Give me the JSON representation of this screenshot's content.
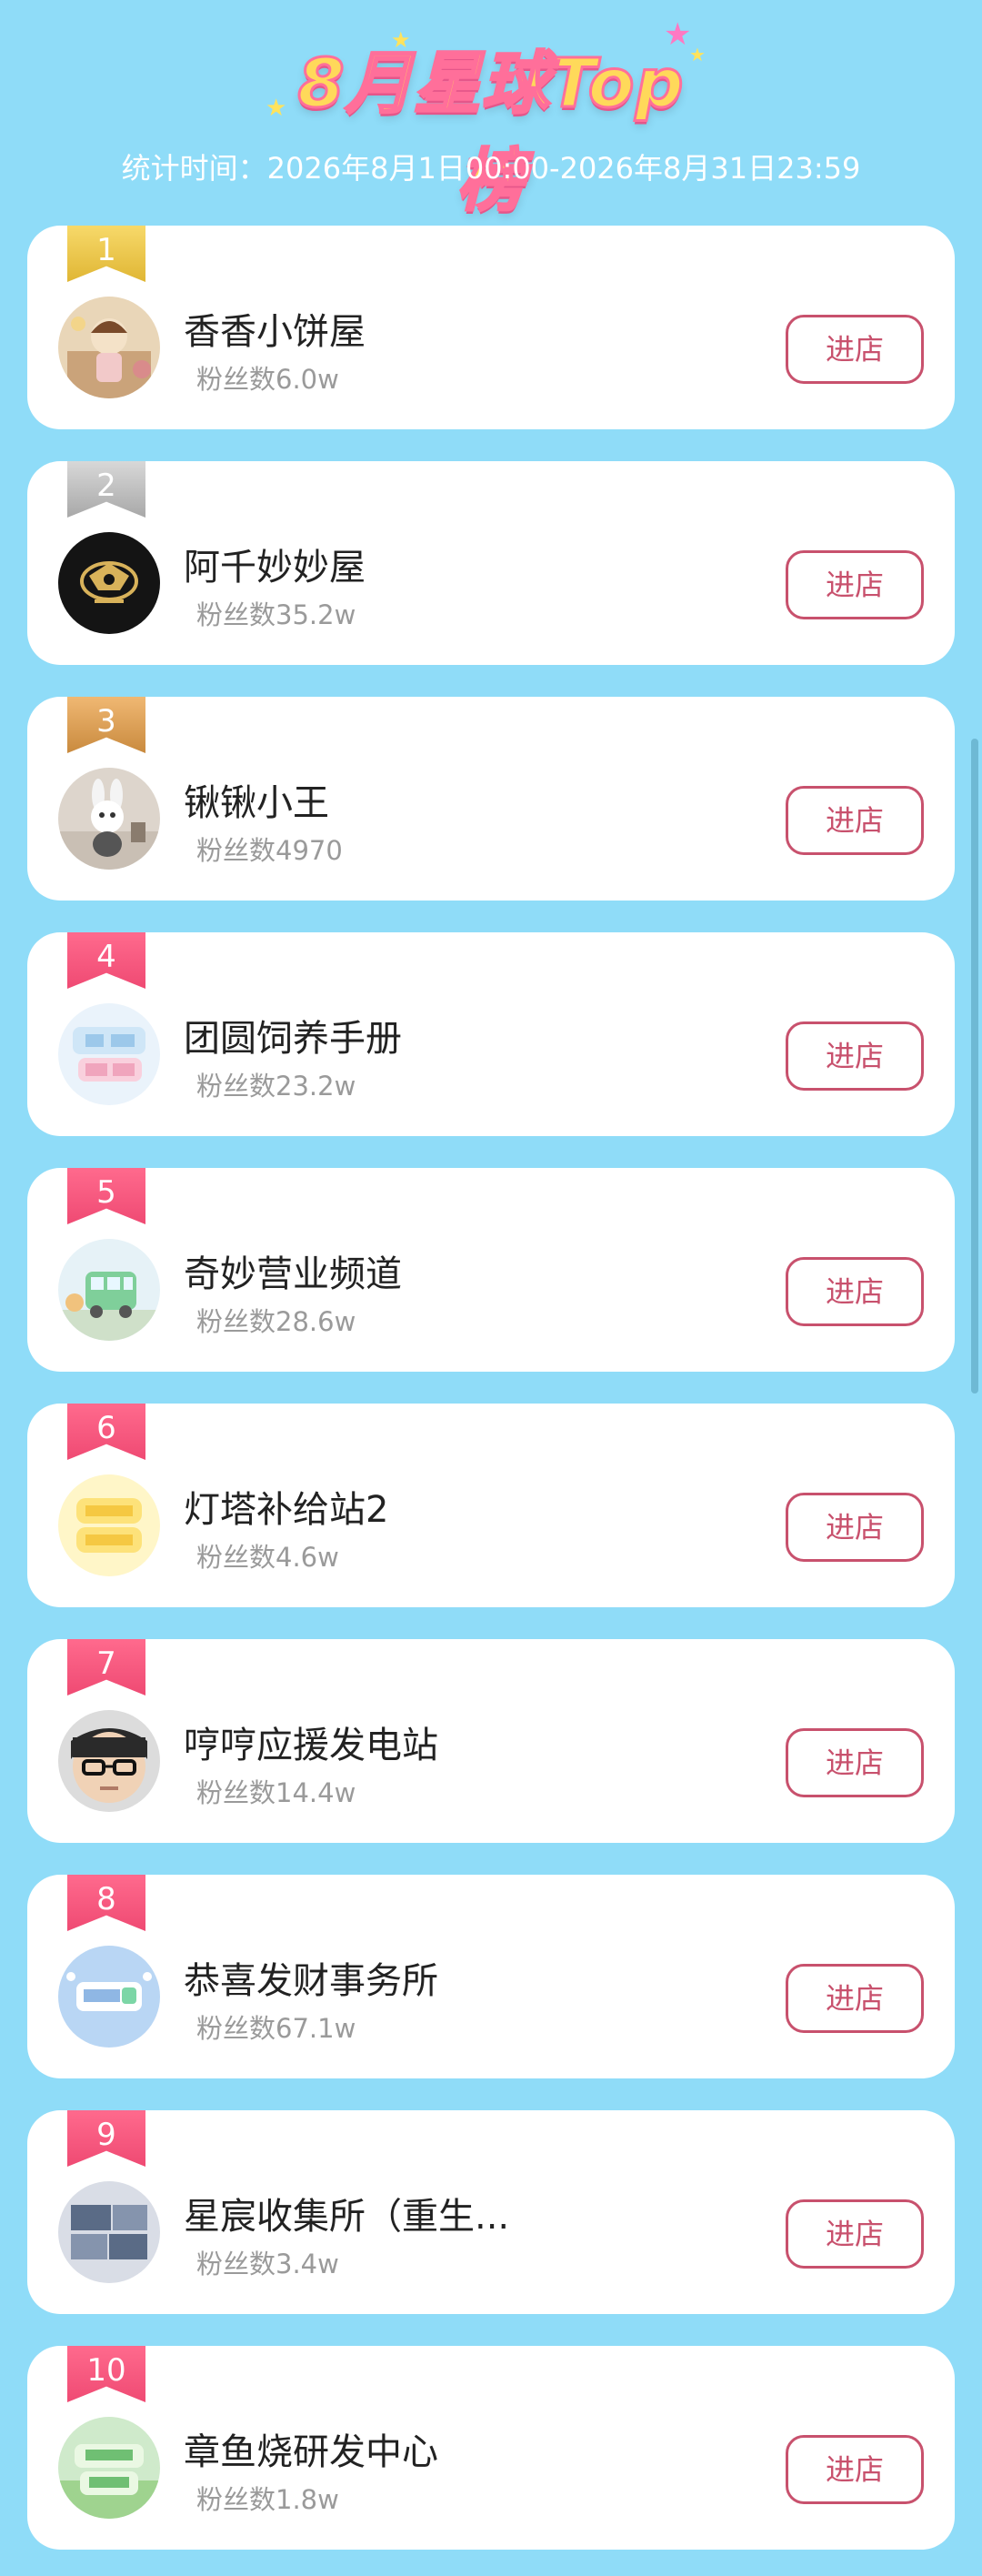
{
  "header": {
    "title": "8月星球Top榜",
    "stat_time": "统计时间：2026年8月1日00:00-2026年8月31日23:59"
  },
  "colors": {
    "background": "#8fdcf8",
    "accent": "#c8516d",
    "rank_gold": "#e0b634",
    "rank_silver": "#a8a8a8",
    "rank_bronze": "#c98a3e",
    "rank_pink": "#ef4a73"
  },
  "enter_label": "进店",
  "shops": [
    {
      "rank": "1",
      "name": "香香小饼屋",
      "fans": "粉丝数6.0w",
      "avatar": "figure-photo-avatar"
    },
    {
      "rank": "2",
      "name": "阿千妙妙屋",
      "fans": "粉丝数35.2w",
      "avatar": "gold-emblem-avatar"
    },
    {
      "rank": "3",
      "name": "锹锹小王",
      "fans": "粉丝数4970",
      "avatar": "plush-toy-avatar"
    },
    {
      "rank": "4",
      "name": "团圆饲养手册",
      "fans": "粉丝数23.2w",
      "avatar": "handbook-logo-avatar"
    },
    {
      "rank": "5",
      "name": "奇妙营业频道",
      "fans": "粉丝数28.6w",
      "avatar": "cartoon-bus-avatar"
    },
    {
      "rank": "6",
      "name": "灯塔补给站2",
      "fans": "粉丝数4.6w",
      "avatar": "yellow-logo-avatar"
    },
    {
      "rank": "7",
      "name": "哼哼应援发电站",
      "fans": "粉丝数14.4w",
      "avatar": "face-glasses-avatar"
    },
    {
      "rank": "8",
      "name": "恭喜发财事务所",
      "fans": "粉丝数67.1w",
      "avatar": "blue-badge-avatar"
    },
    {
      "rank": "9",
      "name": "星宸收集所（重生...",
      "fans": "粉丝数3.4w",
      "avatar": "gray-logo-avatar"
    },
    {
      "rank": "10",
      "name": "章鱼烧研发中心",
      "fans": "粉丝数1.8w",
      "avatar": "green-logo-avatar"
    }
  ]
}
